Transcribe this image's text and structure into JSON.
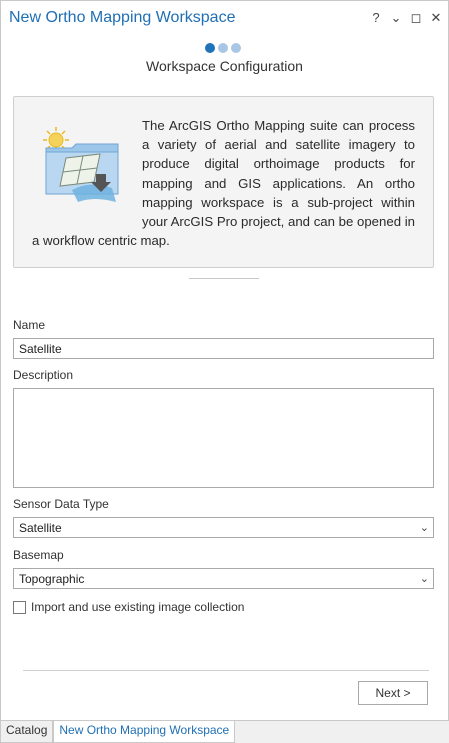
{
  "window": {
    "title": "New Ortho Mapping Workspace",
    "controls": [
      "?",
      "⌄",
      "◻",
      "✕"
    ]
  },
  "wizard": {
    "step_count": 3,
    "active_step": 1,
    "step_title": "Workspace Configuration"
  },
  "info": {
    "text": "The ArcGIS Ortho Mapping suite can process a variety of aerial and satellite imagery to produce digital orthoimage products for mapping and GIS applications. An ortho mapping workspace is a sub-project within your ArcGIS Pro project, and can be opened in a workflow centric map.",
    "icon": "ortho-mapping-icon"
  },
  "form": {
    "name_label": "Name",
    "name_value": "Satellite",
    "description_label": "Description",
    "description_value": "",
    "sensor_label": "Sensor Data Type",
    "sensor_value": "Satellite",
    "basemap_label": "Basemap",
    "basemap_value": "Topographic",
    "import_label": "Import and use existing image collection",
    "import_checked": false
  },
  "buttons": {
    "next_label": "Next >"
  },
  "tabs": [
    {
      "label": "Catalog",
      "active": false
    },
    {
      "label": "New Ortho Mapping Workspace",
      "active": true
    }
  ],
  "colors": {
    "accent": "#1f6fb5",
    "step_active": "#2073b8",
    "step_inactive": "#a9c7e4"
  }
}
